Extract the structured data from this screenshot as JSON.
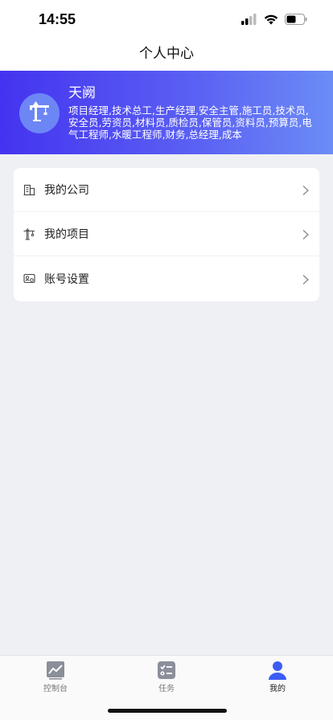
{
  "status_bar": {
    "time": "14:55"
  },
  "nav": {
    "title": "个人中心"
  },
  "profile": {
    "name": "天阙",
    "roles": "项目经理,技术总工,生产经理,安全主管,施工员,技术员,安全员,劳资员,材料员,质检员,保管员,资料员,预算员,电气工程师,水暖工程师,财务,总经理,成本",
    "avatar_icon": "crane-icon"
  },
  "menu": {
    "items": [
      {
        "label": "我的公司",
        "icon": "building-icon"
      },
      {
        "label": "我的项目",
        "icon": "crane-icon"
      },
      {
        "label": "账号设置",
        "icon": "id-card-icon"
      }
    ]
  },
  "tabs": [
    {
      "label": "控制台",
      "icon": "chart-icon",
      "active": false
    },
    {
      "label": "任务",
      "icon": "task-list-icon",
      "active": false
    },
    {
      "label": "我的",
      "icon": "user-icon",
      "active": true
    }
  ],
  "colors": {
    "banner_start": "#4433f0",
    "banner_end": "#6c8cf6",
    "active_tab": "#3b5cf5"
  }
}
